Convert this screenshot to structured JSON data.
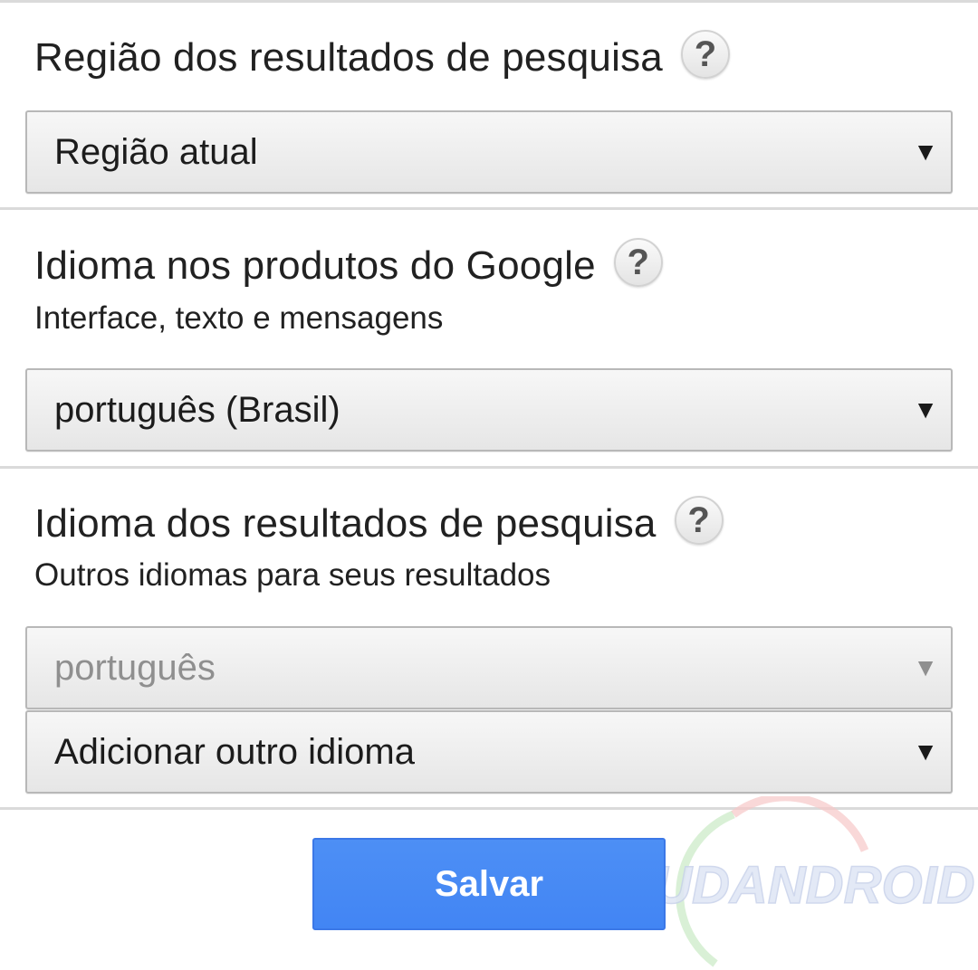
{
  "sections": [
    {
      "title": "Região dos resultados de pesquisa",
      "help": "?",
      "select": {
        "value": "Região atual",
        "caret": "▼"
      }
    },
    {
      "title": "Idioma nos produtos do Google",
      "help": "?",
      "subtitle": "Interface, texto e mensagens",
      "select": {
        "value": "português (Brasil)",
        "caret": "▼"
      }
    },
    {
      "title": "Idioma dos resultados de pesquisa",
      "help": "?",
      "subtitle": "Outros idiomas para seus resultados",
      "select_primary": {
        "value": "português",
        "caret": "▼",
        "disabled": true
      },
      "select_add": {
        "value": "Adicionar outro idioma",
        "caret": "▼"
      }
    }
  ],
  "save_button": {
    "label": "Salvar",
    "color": "#4285f4"
  },
  "watermark": {
    "text": "AJUDANDROID"
  },
  "colors": {
    "divider": "#dadada",
    "select_border": "#b8b8b8",
    "disabled_text": "#8f8f8f"
  }
}
